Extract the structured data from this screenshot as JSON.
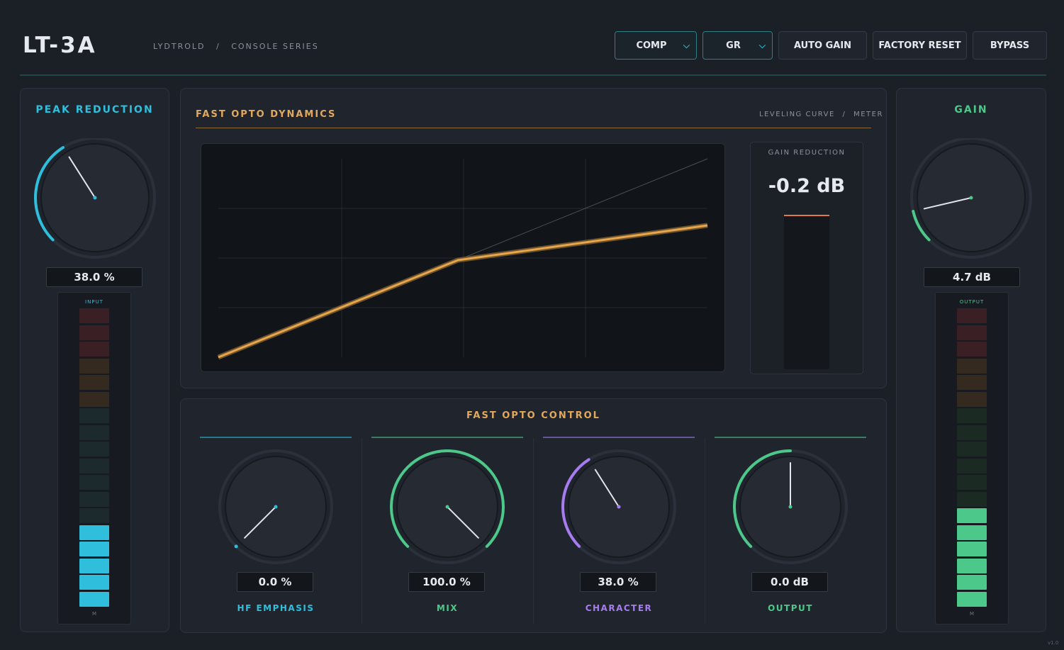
{
  "app": {
    "title": "LT-3A",
    "brand": "LYDTROLD",
    "separator": "/",
    "series": "CONSOLE SERIES",
    "version": "v1.0"
  },
  "toolbar": {
    "mode_select": {
      "value": "COMP"
    },
    "meter_select": {
      "value": "GR"
    },
    "auto_gain_label": "AUTO GAIN",
    "factory_reset_label": "FACTORY RESET",
    "bypass_label": "BYPASS"
  },
  "peak_reduction": {
    "title": "PEAK REDUCTION",
    "value_text": "38.0 %",
    "value": 0.38,
    "color": "#2fbfdc",
    "meter": {
      "label": "INPUT",
      "foot": "M",
      "lit_segments": 5,
      "total_segments": 18
    }
  },
  "gain": {
    "title": "GAIN",
    "value_text": "4.7 dB",
    "value": 0.118,
    "color": "#4cc98a",
    "meter": {
      "label": "OUTPUT",
      "foot": "M",
      "lit_segments": 6,
      "total_segments": 18
    }
  },
  "dynamics": {
    "title": "FAST OPTO DYNAMICS",
    "subtitle_left": "LEVELING CURVE",
    "subtitle_sep": "/",
    "subtitle_right": "METER",
    "gain_reduction_label": "GAIN REDUCTION",
    "gain_reduction_value": "-0.2 dB",
    "curve_color": "#e8a54a"
  },
  "controls": {
    "title": "FAST OPTO CONTROL",
    "knobs": [
      {
        "id": "hf-emphasis",
        "label": "HF EMPHASIS",
        "value_text": "0.0 %",
        "value": 0.0,
        "color": "#2fbfdc"
      },
      {
        "id": "mix",
        "label": "MIX",
        "value_text": "100.0 %",
        "value": 1.0,
        "color": "#4cc98a"
      },
      {
        "id": "character",
        "label": "CHARACTER",
        "value_text": "38.0 %",
        "value": 0.38,
        "color": "#a67cf0"
      },
      {
        "id": "output",
        "label": "OUTPUT",
        "value_text": "0.0 dB",
        "value": 0.5,
        "color": "#4cc98a"
      }
    ]
  }
}
